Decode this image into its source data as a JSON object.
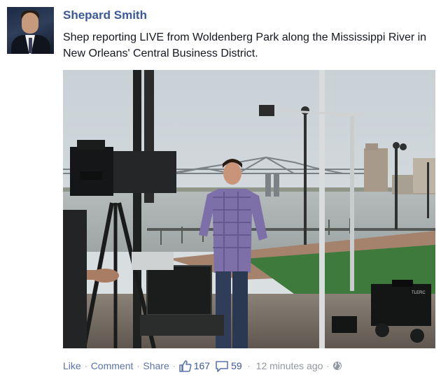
{
  "post": {
    "author": "Shepard Smith",
    "message": "Shep reporting LIVE from Woldenberg Park along the Mississippi River in New Orleans' Central Business District."
  },
  "photo": {
    "sign_text": "TLERC"
  },
  "actions": {
    "like_label": "Like",
    "comment_label": "Comment",
    "share_label": "Share",
    "like_count": "167",
    "comment_count": "59",
    "timestamp": "12 minutes ago",
    "separator": "·"
  },
  "colors": {
    "link": "#5b74a8",
    "author": "#3b5998",
    "meta": "#9197a3"
  },
  "icons": [
    "thumbs-up-icon",
    "comment-bubble-icon",
    "globe-icon"
  ]
}
